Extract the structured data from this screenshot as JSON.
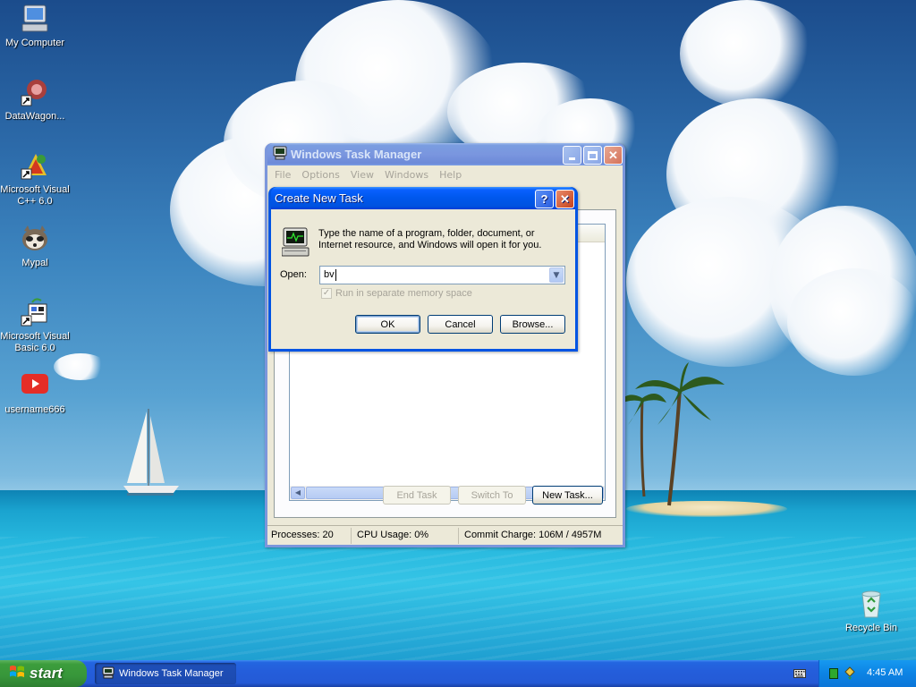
{
  "desktop": {
    "icons": [
      {
        "label": "My Computer",
        "icon": "my-computer-icon"
      },
      {
        "label": "DataWagon...",
        "icon": "datawagon-icon"
      },
      {
        "label": "Microsoft Visual C++ 6.0",
        "icon": "visual-cpp-icon"
      },
      {
        "label": "Mypal",
        "icon": "mypal-icon"
      },
      {
        "label": "Microsoft Visual Basic 6.0",
        "icon": "visual-basic-icon"
      },
      {
        "label": "username666",
        "icon": "youtube-icon"
      },
      {
        "label": "Recycle Bin",
        "icon": "recycle-bin-icon"
      }
    ]
  },
  "task_manager": {
    "title": "Windows Task Manager",
    "menu": [
      "File",
      "Options",
      "View",
      "Windows",
      "Help"
    ],
    "buttons": {
      "end_task": "End Task",
      "switch_to": "Switch To",
      "new_task": "New Task..."
    },
    "status": {
      "processes": "Processes: 20",
      "cpu": "CPU Usage: 0%",
      "commit": "Commit Charge: 106M / 4957M"
    }
  },
  "dialog": {
    "title": "Create New Task",
    "message": "Type the name of a program, folder, document, or Internet resource, and Windows will open it for you.",
    "open_label": "Open:",
    "open_value": "bv",
    "checkbox_label": "Run in separate memory space",
    "checkbox_checked": true,
    "checkbox_enabled": false,
    "buttons": {
      "ok": "OK",
      "cancel": "Cancel",
      "browse": "Browse..."
    }
  },
  "taskbar": {
    "start_label": "start",
    "items": [
      {
        "label": "Windows Task Manager"
      }
    ],
    "clock": "4:45 AM"
  },
  "colors": {
    "title_active": "#0058ee",
    "dialog_face": "#ece9d8",
    "start_green": "#3c9d3c",
    "taskbar_blue": "#245edb",
    "tray_blue": "#0c83e4"
  }
}
